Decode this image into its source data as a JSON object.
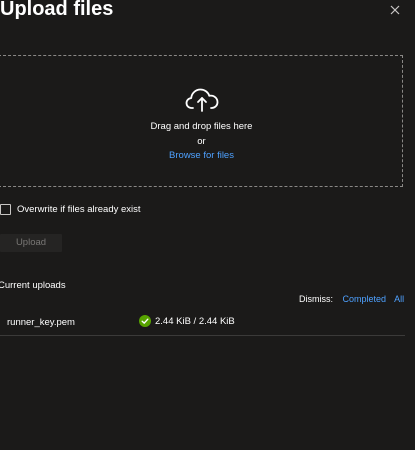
{
  "dialog": {
    "title": "Upload files",
    "close_icon": "close-icon"
  },
  "dropzone": {
    "icon": "cloud-upload-icon",
    "instruction": "Drag and drop files here",
    "or_text": "or",
    "browse_label": "Browse for files"
  },
  "options": {
    "overwrite_label": "Overwrite if files already exist",
    "overwrite_checked": false
  },
  "actions": {
    "upload_label": "Upload",
    "upload_enabled": false
  },
  "uploads": {
    "section_title": "Current uploads",
    "dismiss_label": "Dismiss:",
    "dismiss_completed": "Completed",
    "dismiss_all": "All",
    "items": [
      {
        "file_name": "runner_key.pem",
        "status_icon": "check-circle-icon",
        "progress_text": "2.44 KiB / 2.44 KiB",
        "progress_fraction": 1.0
      }
    ]
  },
  "colors": {
    "background": "#1b1a19",
    "link": "#4ea1ff",
    "success": "#57a300",
    "border": "#8a8886"
  }
}
